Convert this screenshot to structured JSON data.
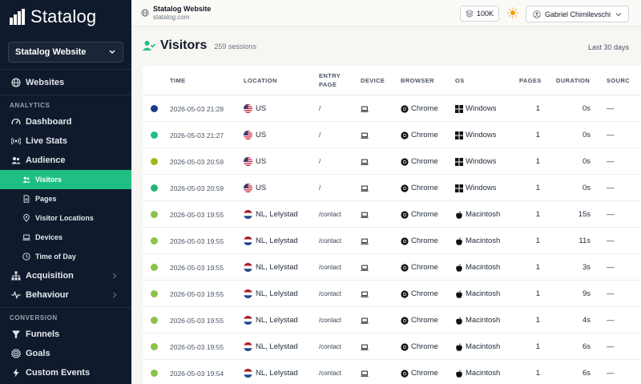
{
  "app": {
    "name": "Statalog"
  },
  "sidebar": {
    "site_selector": "Statalog Website",
    "websites": "Websites",
    "sections": {
      "analytics": "ANALYTICS",
      "conversion": "CONVERSION"
    },
    "items": {
      "dashboard": "Dashboard",
      "live_stats": "Live Stats",
      "audience": "Audience",
      "visitors": "Visitors",
      "pages": "Pages",
      "visitor_locations": "Visitor Locations",
      "devices": "Devices",
      "time_of_day": "Time of Day",
      "acquisition": "Acquisition",
      "behaviour": "Behaviour",
      "funnels": "Funnels",
      "goals": "Goals",
      "custom_events": "Custom Events"
    }
  },
  "topbar": {
    "site_name": "Statalog Website",
    "site_url": "statalog.com",
    "plan_badge": "100K",
    "user_name": "Gabriel Chimilevschi"
  },
  "page": {
    "title": "Visitors",
    "sessions": "259 sessions",
    "period": "Last 30 days"
  },
  "table": {
    "headers": {
      "time": "TIME",
      "location": "LOCATION",
      "entry1": "ENTRY",
      "entry2": "PAGE",
      "device": "DEVICE",
      "browser": "BROWSER",
      "os": "OS",
      "pages": "PAGES",
      "duration": "DURATION",
      "source": "SOURC"
    },
    "rows": [
      {
        "dot": "#1e3a8a",
        "time": "2026-05-03 21:28",
        "flag": "us",
        "location": "US",
        "entry": "/",
        "browser": "Chrome",
        "os": "Windows",
        "os_icon": "windows",
        "pages": "1",
        "duration": "0s",
        "source": "—"
      },
      {
        "dot": "#1fbf83",
        "time": "2026-05-03 21:27",
        "flag": "us",
        "location": "US",
        "entry": "/",
        "browser": "Chrome",
        "os": "Windows",
        "os_icon": "windows",
        "pages": "1",
        "duration": "0s",
        "source": "—"
      },
      {
        "dot": "#a3b51a",
        "time": "2026-05-03 20:59",
        "flag": "us",
        "location": "US",
        "entry": "/",
        "browser": "Chrome",
        "os": "Windows",
        "os_icon": "windows",
        "pages": "1",
        "duration": "0s",
        "source": "—"
      },
      {
        "dot": "#22b573",
        "time": "2026-05-03 20:59",
        "flag": "us",
        "location": "US",
        "entry": "/",
        "browser": "Chrome",
        "os": "Windows",
        "os_icon": "windows",
        "pages": "1",
        "duration": "0s",
        "source": "—"
      },
      {
        "dot": "#8bc34a",
        "time": "2026-05-03 19:55",
        "flag": "nl",
        "location": "NL, Lelystad",
        "entry": "/contact",
        "browser": "Chrome",
        "os": "Macintosh",
        "os_icon": "apple",
        "pages": "1",
        "duration": "15s",
        "source": "—"
      },
      {
        "dot": "#8bc34a",
        "time": "2026-05-03 19:55",
        "flag": "nl",
        "location": "NL, Lelystad",
        "entry": "/contact",
        "browser": "Chrome",
        "os": "Macintosh",
        "os_icon": "apple",
        "pages": "1",
        "duration": "11s",
        "source": "—"
      },
      {
        "dot": "#8bc34a",
        "time": "2026-05-03 19:55",
        "flag": "nl",
        "location": "NL, Lelystad",
        "entry": "/contact",
        "browser": "Chrome",
        "os": "Macintosh",
        "os_icon": "apple",
        "pages": "1",
        "duration": "3s",
        "source": "—"
      },
      {
        "dot": "#8bc34a",
        "time": "2026-05-03 19:55",
        "flag": "nl",
        "location": "NL, Lelystad",
        "entry": "/contact",
        "browser": "Chrome",
        "os": "Macintosh",
        "os_icon": "apple",
        "pages": "1",
        "duration": "9s",
        "source": "—"
      },
      {
        "dot": "#8bc34a",
        "time": "2026-05-03 19:55",
        "flag": "nl",
        "location": "NL, Lelystad",
        "entry": "/contact",
        "browser": "Chrome",
        "os": "Macintosh",
        "os_icon": "apple",
        "pages": "1",
        "duration": "4s",
        "source": "—"
      },
      {
        "dot": "#8bc34a",
        "time": "2026-05-03 19:55",
        "flag": "nl",
        "location": "NL, Lelystad",
        "entry": "/contact",
        "browser": "Chrome",
        "os": "Macintosh",
        "os_icon": "apple",
        "pages": "1",
        "duration": "6s",
        "source": "—"
      },
      {
        "dot": "#8bc34a",
        "time": "2026-05-03 19:54",
        "flag": "nl",
        "location": "NL, Lelystad",
        "entry": "/contact",
        "browser": "Chrome",
        "os": "Macintosh",
        "os_icon": "apple",
        "pages": "1",
        "duration": "6s",
        "source": "—"
      }
    ]
  }
}
